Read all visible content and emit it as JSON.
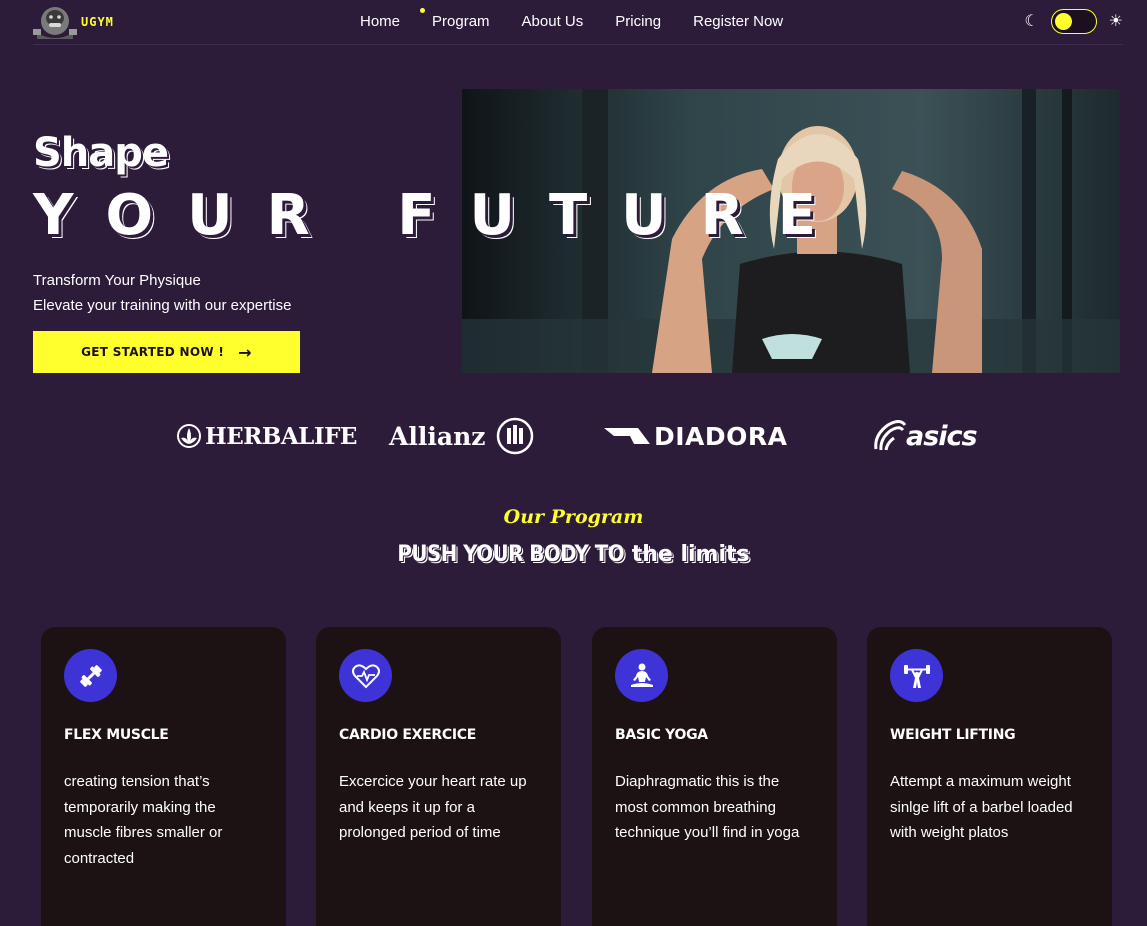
{
  "brand": {
    "logo_text": "UGYM"
  },
  "nav": {
    "items": [
      {
        "label": "Home"
      },
      {
        "label": "Program"
      },
      {
        "label": "About Us"
      },
      {
        "label": "Pricing"
      },
      {
        "label": "Register Now"
      }
    ],
    "active_index": 1
  },
  "theme": {
    "moon_icon": "☾",
    "sun_icon": "☀",
    "mode": "dark"
  },
  "hero": {
    "title_small": "Shape",
    "title_large": "YOUR FUTURE",
    "subtitle_line1": "Transform Your Physique",
    "subtitle_line2": "Elevate your training with our expertise",
    "cta_label": "GET STARTED NOW !",
    "cta_icon": "→",
    "image_alt": "woman-training-in-nike-top"
  },
  "partners": [
    {
      "name": "HERBALIFE"
    },
    {
      "name": "Allianz"
    },
    {
      "name": "DIADORA"
    },
    {
      "name": "asics"
    }
  ],
  "program": {
    "eyebrow": "Our Program",
    "title_part1": "PUSH YOUR BODY TO",
    "title_part2": "the limits",
    "cards": [
      {
        "icon": "dumbbell-icon",
        "title": "FLEX MUSCLE",
        "text": "creating tension that’s temporarily making the muscle fibres smaller or contracted"
      },
      {
        "icon": "heart-pulse-icon",
        "title": "CARDIO EXERCICE",
        "text": "Excercice your heart rate up and keeps it up for a prolonged period of time"
      },
      {
        "icon": "yoga-icon",
        "title": "BASIC YOGA",
        "text": "Diaphragmatic this is the most common breathing technique you’ll find in yoga"
      },
      {
        "icon": "weightlifting-icon",
        "title": "WEIGHT LIFTING",
        "text": "Attempt a maximum weight sinlge lift of a barbel loaded with weight platos"
      }
    ]
  },
  "colors": {
    "background": "#2d1b3a",
    "accent": "#ffff2e",
    "card": "#1c1214",
    "icon_circle": "#3d33d6"
  }
}
